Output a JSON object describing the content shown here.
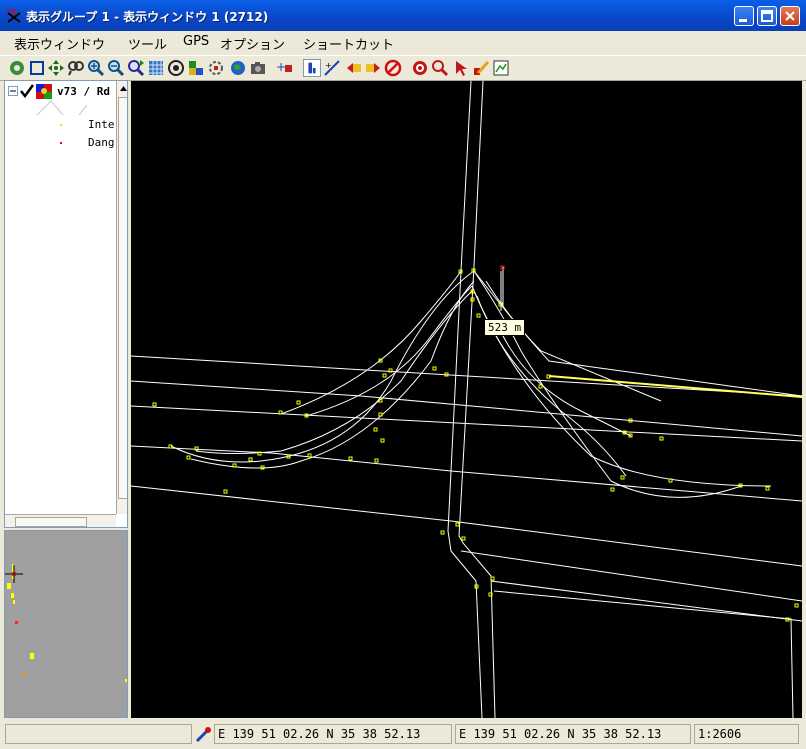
{
  "window": {
    "title": "表示グループ 1  - 表示ウィンドウ 1 (2712)"
  },
  "menu": {
    "items": [
      "表示ウィンドウ",
      "ツール",
      "GPS",
      "オプション",
      "ショートカット"
    ]
  },
  "layers": {
    "layer_name": "v73 / Rd",
    "legend": [
      "Inte",
      "Dang"
    ]
  },
  "map": {
    "measure_label": "523 m"
  },
  "status": {
    "coord_primary": "E 139 51 02.26  N 35 38 52.13",
    "coord_secondary": "E 139 51 02.26  N 35 38 52.13",
    "scale": "1:2606"
  },
  "colors": {
    "title_bar": "#0A50D8",
    "map_background": "#000000",
    "map_lines": "#FFFFFF",
    "vertex": "#FFFF00",
    "highlight": "#FF0000",
    "tooltip": "#FFFFE1"
  }
}
